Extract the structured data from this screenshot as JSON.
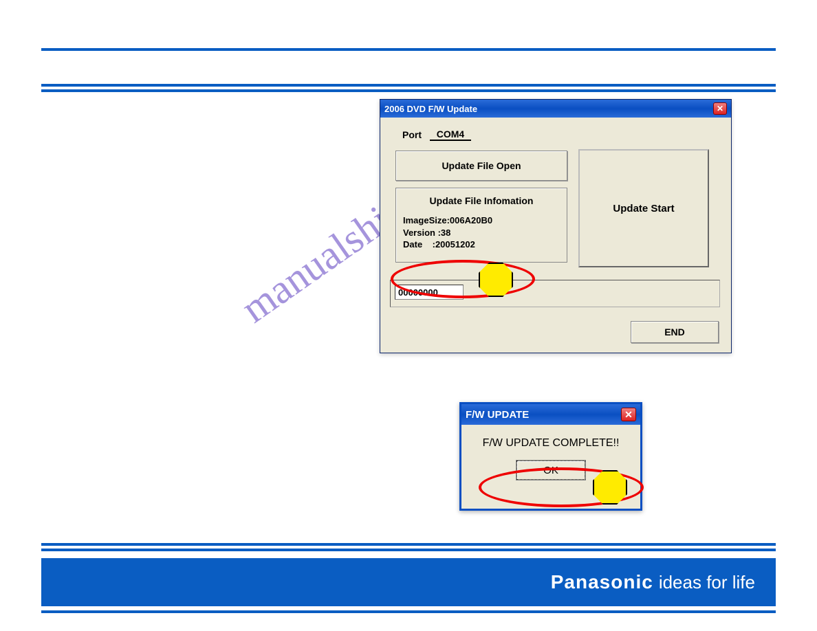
{
  "watermark": "manualshive.com",
  "footer": {
    "brand": "Panasonic",
    "slogan": "ideas for life"
  },
  "win1": {
    "title": "2006 DVD F/W Update",
    "port_label": "Port",
    "port_value": "COM4",
    "open_button": "Update File Open",
    "info_header": "Update File Infomation",
    "info_image_size": "ImageSize:006A20B0",
    "info_version": "Version :38",
    "info_date": "Date    :20051202",
    "start_button": "Update Start",
    "counter": "00000000",
    "end_button": "END"
  },
  "win2": {
    "title": "F/W UPDATE",
    "message": "F/W UPDATE COMPLETE!!",
    "ok_button": "OK"
  }
}
